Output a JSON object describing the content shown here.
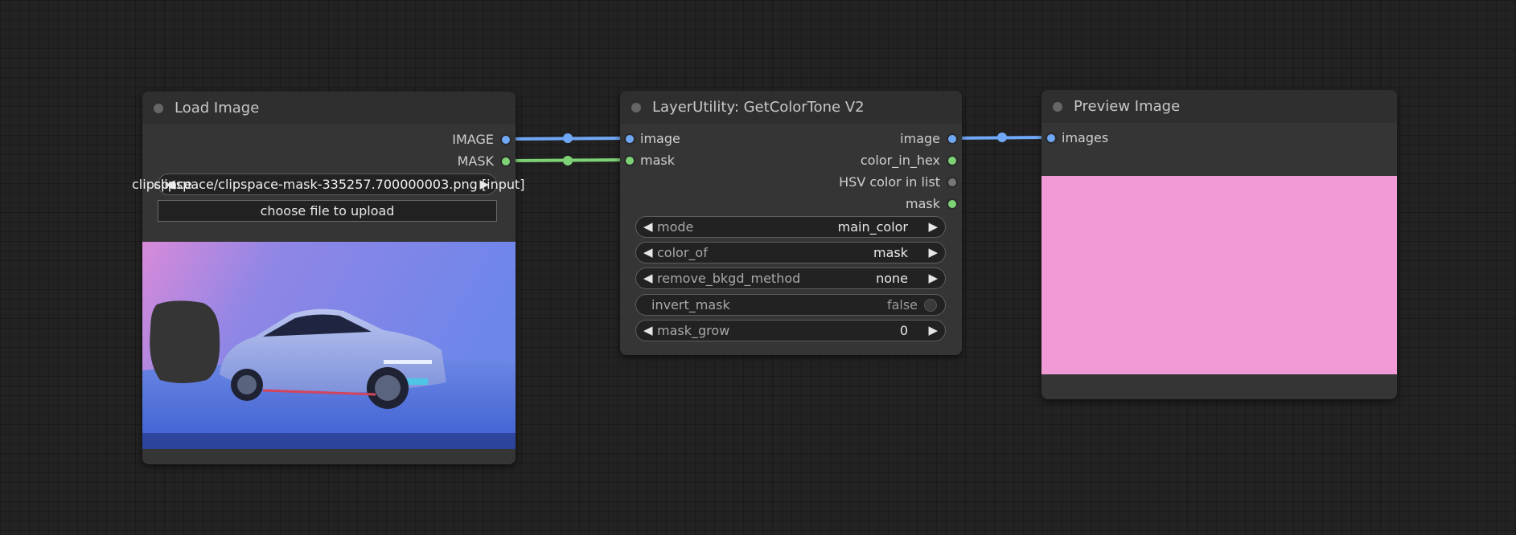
{
  "nodes": {
    "load_image": {
      "title": "Load Image",
      "outputs": [
        "IMAGE",
        "MASK"
      ],
      "image_widget_value": "clipspace/clipspace-mask-335257.700000003.png [input]",
      "image_widget_overlap": "clipspace",
      "upload_label": "choose file to upload"
    },
    "get_color_tone": {
      "title": "LayerUtility: GetColorTone V2",
      "inputs": [
        "image",
        "mask"
      ],
      "outputs": [
        "image",
        "color_in_hex",
        "HSV color in list",
        "mask"
      ],
      "widgets": {
        "mode": {
          "label": "mode",
          "value": "main_color"
        },
        "color_of": {
          "label": "color_of",
          "value": "mask"
        },
        "remove_bkgd_method": {
          "label": "remove_bkgd_method",
          "value": "none"
        },
        "invert_mask": {
          "label": "invert_mask",
          "value": "false"
        },
        "mask_grow": {
          "label": "mask_grow",
          "value": "0"
        }
      }
    },
    "preview_image": {
      "title": "Preview Image",
      "inputs": [
        "images"
      ],
      "preview_color": "#f19ad6"
    }
  },
  "colors": {
    "canvas": "#222222",
    "node_body": "#353535",
    "image_link": "#6fa8f6",
    "mask_link": "#7dd276"
  },
  "icons": {
    "arrow_left": "◀",
    "arrow_right": "▶"
  }
}
